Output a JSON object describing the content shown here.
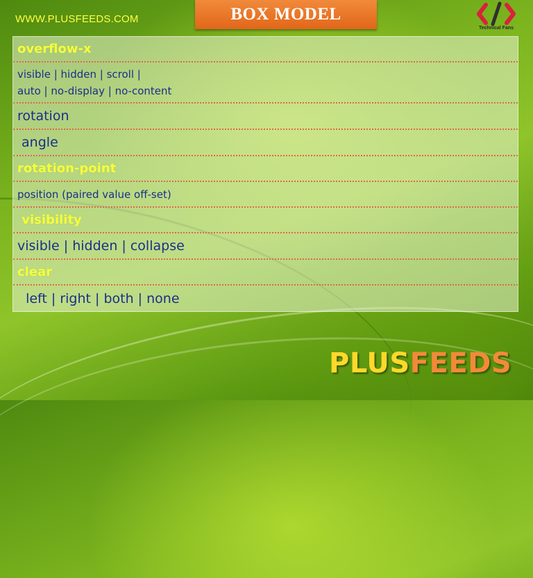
{
  "header": {
    "site_url": "WWW.PLUSFEEDS.COM",
    "title": "BOX MODEL",
    "logo_caption": "Technical Fans",
    "logo_icon": "code-brackets-icon"
  },
  "rows": [
    {
      "text": "overflow-x",
      "kind": "property"
    },
    {
      "text": "visible | hidden | scroll |\nauto | no-display | no-content",
      "kind": "value"
    },
    {
      "text": "rotation",
      "kind": "value"
    },
    {
      "text": " angle",
      "kind": "value"
    },
    {
      "text": "rotation-point",
      "kind": "property"
    },
    {
      "text": "position (paired value off-set)",
      "kind": "value"
    },
    {
      "text": " visibility",
      "kind": "property"
    },
    {
      "text": "visible | hidden | collapse",
      "kind": "value"
    },
    {
      "text": "clear",
      "kind": "property"
    },
    {
      "text": "  left | right | both | none",
      "kind": "value"
    }
  ],
  "footer": {
    "brand_plus": "PLUS",
    "brand_feeds": "FEEDS"
  },
  "colors": {
    "property_text": "#f7ff3a",
    "value_text": "#1a2f8a",
    "divider": "#e06848",
    "title_box": "#e8742a",
    "background": "#7bb41e"
  }
}
